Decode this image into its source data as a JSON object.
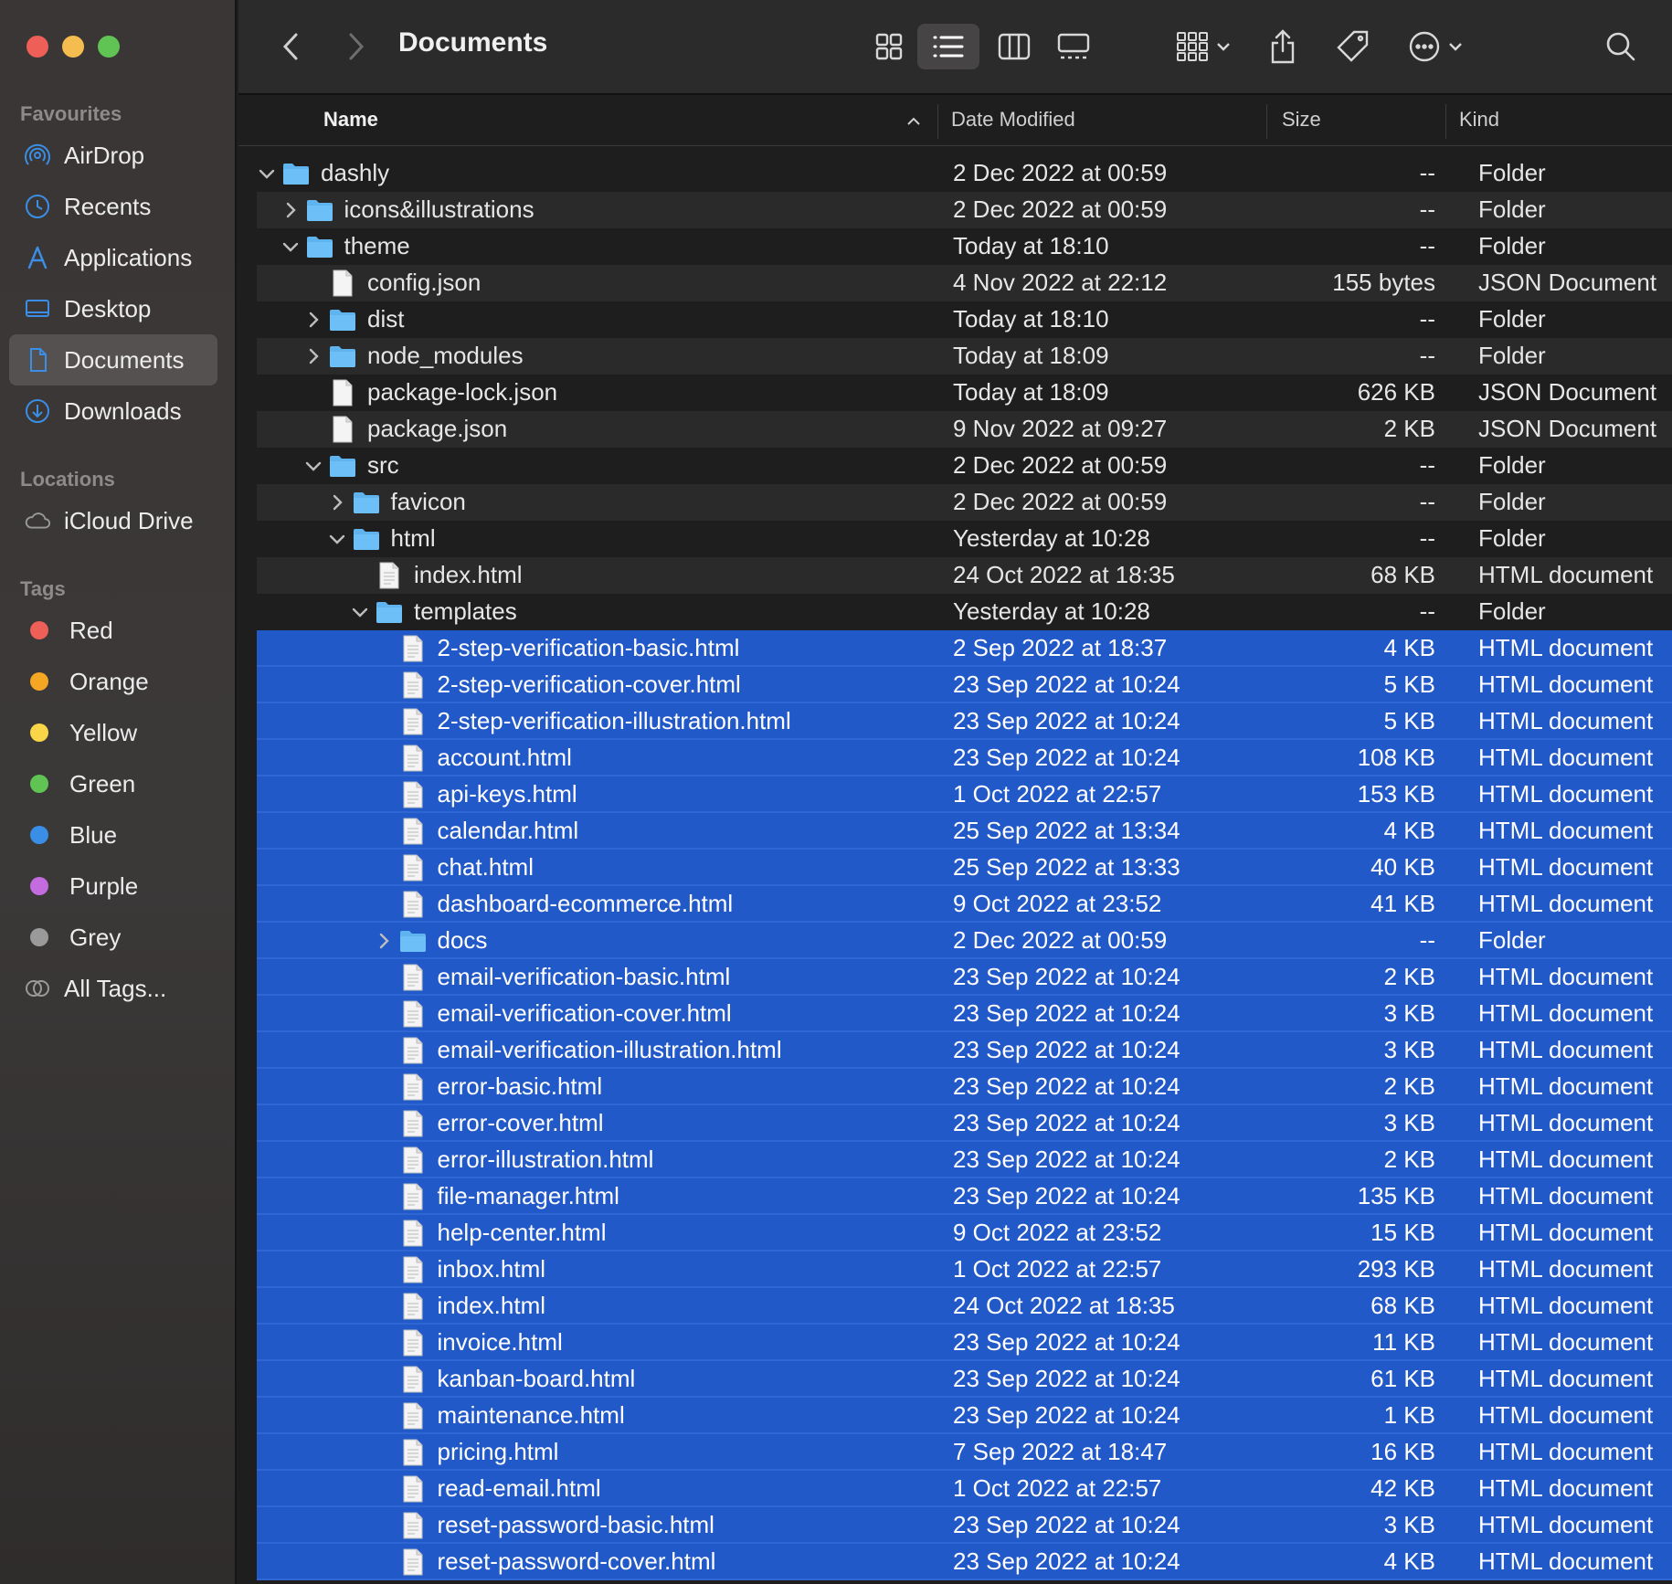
{
  "window": {
    "title": "Documents",
    "colors": {
      "selection": "#2259c9",
      "folder": "#5fb4f0",
      "sidebar_accent": "#3a8ee6"
    }
  },
  "sidebar": {
    "favourites_label": "Favourites",
    "favourites": [
      {
        "label": "AirDrop",
        "icon": "airdrop-icon"
      },
      {
        "label": "Recents",
        "icon": "clock-icon"
      },
      {
        "label": "Applications",
        "icon": "applications-icon"
      },
      {
        "label": "Desktop",
        "icon": "desktop-icon"
      },
      {
        "label": "Documents",
        "icon": "document-icon",
        "active": true
      },
      {
        "label": "Downloads",
        "icon": "download-icon"
      }
    ],
    "locations_label": "Locations",
    "locations": [
      {
        "label": "iCloud Drive",
        "icon": "cloud-icon"
      }
    ],
    "tags_label": "Tags",
    "tags": [
      {
        "label": "Red",
        "color": "#ed5f57"
      },
      {
        "label": "Orange",
        "color": "#f5a623"
      },
      {
        "label": "Yellow",
        "color": "#f8d648"
      },
      {
        "label": "Green",
        "color": "#5fc453"
      },
      {
        "label": "Blue",
        "color": "#3a8ee6"
      },
      {
        "label": "Purple",
        "color": "#c46be0"
      },
      {
        "label": "Grey",
        "color": "#9a9a9a"
      },
      {
        "label": "All Tags...",
        "color": ""
      }
    ]
  },
  "columns": {
    "name": "Name",
    "date": "Date Modified",
    "size": "Size",
    "kind": "Kind"
  },
  "files": [
    {
      "name": "dashly",
      "date": "2 Dec 2022 at 00:59",
      "size": "--",
      "kind": "Folder",
      "type": "folder",
      "level": 0,
      "expanded": true
    },
    {
      "name": "icons&illustrations",
      "date": "2 Dec 2022 at 00:59",
      "size": "--",
      "kind": "Folder",
      "type": "folder",
      "level": 1,
      "expanded": false
    },
    {
      "name": "theme",
      "date": "Today at 18:10",
      "size": "--",
      "kind": "Folder",
      "type": "folder",
      "level": 1,
      "expanded": true
    },
    {
      "name": "config.json",
      "date": "4 Nov 2022 at 22:12",
      "size": "155 bytes",
      "kind": "JSON Document",
      "type": "file",
      "level": 2
    },
    {
      "name": "dist",
      "date": "Today at 18:10",
      "size": "--",
      "kind": "Folder",
      "type": "folder",
      "level": 2,
      "expanded": false
    },
    {
      "name": "node_modules",
      "date": "Today at 18:09",
      "size": "--",
      "kind": "Folder",
      "type": "folder",
      "level": 2,
      "expanded": false
    },
    {
      "name": "package-lock.json",
      "date": "Today at 18:09",
      "size": "626 KB",
      "kind": "JSON Document",
      "type": "file",
      "level": 2
    },
    {
      "name": "package.json",
      "date": "9 Nov 2022 at 09:27",
      "size": "2 KB",
      "kind": "JSON Document",
      "type": "file",
      "level": 2
    },
    {
      "name": "src",
      "date": "2 Dec 2022 at 00:59",
      "size": "--",
      "kind": "Folder",
      "type": "folder",
      "level": 2,
      "expanded": true
    },
    {
      "name": "favicon",
      "date": "2 Dec 2022 at 00:59",
      "size": "--",
      "kind": "Folder",
      "type": "folder",
      "level": 3,
      "expanded": false
    },
    {
      "name": "html",
      "date": "Yesterday at 10:28",
      "size": "--",
      "kind": "Folder",
      "type": "folder",
      "level": 3,
      "expanded": true
    },
    {
      "name": "index.html",
      "date": "24 Oct 2022 at 18:35",
      "size": "68 KB",
      "kind": "HTML document",
      "type": "file",
      "level": 4
    },
    {
      "name": "templates",
      "date": "Yesterday at 10:28",
      "size": "--",
      "kind": "Folder",
      "type": "folder",
      "level": 4,
      "expanded": true
    },
    {
      "name": "2-step-verification-basic.html",
      "date": "2 Sep 2022 at 18:37",
      "size": "4 KB",
      "kind": "HTML document",
      "type": "file",
      "level": 5,
      "selected": true
    },
    {
      "name": "2-step-verification-cover.html",
      "date": "23 Sep 2022 at 10:24",
      "size": "5 KB",
      "kind": "HTML document",
      "type": "file",
      "level": 5,
      "selected": true
    },
    {
      "name": "2-step-verification-illustration.html",
      "date": "23 Sep 2022 at 10:24",
      "size": "5 KB",
      "kind": "HTML document",
      "type": "file",
      "level": 5,
      "selected": true
    },
    {
      "name": "account.html",
      "date": "23 Sep 2022 at 10:24",
      "size": "108 KB",
      "kind": "HTML document",
      "type": "file",
      "level": 5,
      "selected": true
    },
    {
      "name": "api-keys.html",
      "date": "1 Oct 2022 at 22:57",
      "size": "153 KB",
      "kind": "HTML document",
      "type": "file",
      "level": 5,
      "selected": true
    },
    {
      "name": "calendar.html",
      "date": "25 Sep 2022 at 13:34",
      "size": "4 KB",
      "kind": "HTML document",
      "type": "file",
      "level": 5,
      "selected": true
    },
    {
      "name": "chat.html",
      "date": "25 Sep 2022 at 13:33",
      "size": "40 KB",
      "kind": "HTML document",
      "type": "file",
      "level": 5,
      "selected": true
    },
    {
      "name": "dashboard-ecommerce.html",
      "date": "9 Oct 2022 at 23:52",
      "size": "41 KB",
      "kind": "HTML document",
      "type": "file",
      "level": 5,
      "selected": true
    },
    {
      "name": "docs",
      "date": "2 Dec 2022 at 00:59",
      "size": "--",
      "kind": "Folder",
      "type": "folder",
      "level": 5,
      "expanded": false,
      "selected": true
    },
    {
      "name": "email-verification-basic.html",
      "date": "23 Sep 2022 at 10:24",
      "size": "2 KB",
      "kind": "HTML document",
      "type": "file",
      "level": 5,
      "selected": true
    },
    {
      "name": "email-verification-cover.html",
      "date": "23 Sep 2022 at 10:24",
      "size": "3 KB",
      "kind": "HTML document",
      "type": "file",
      "level": 5,
      "selected": true
    },
    {
      "name": "email-verification-illustration.html",
      "date": "23 Sep 2022 at 10:24",
      "size": "3 KB",
      "kind": "HTML document",
      "type": "file",
      "level": 5,
      "selected": true
    },
    {
      "name": "error-basic.html",
      "date": "23 Sep 2022 at 10:24",
      "size": "2 KB",
      "kind": "HTML document",
      "type": "file",
      "level": 5,
      "selected": true
    },
    {
      "name": "error-cover.html",
      "date": "23 Sep 2022 at 10:24",
      "size": "3 KB",
      "kind": "HTML document",
      "type": "file",
      "level": 5,
      "selected": true
    },
    {
      "name": "error-illustration.html",
      "date": "23 Sep 2022 at 10:24",
      "size": "2 KB",
      "kind": "HTML document",
      "type": "file",
      "level": 5,
      "selected": true
    },
    {
      "name": "file-manager.html",
      "date": "23 Sep 2022 at 10:24",
      "size": "135 KB",
      "kind": "HTML document",
      "type": "file",
      "level": 5,
      "selected": true
    },
    {
      "name": "help-center.html",
      "date": "9 Oct 2022 at 23:52",
      "size": "15 KB",
      "kind": "HTML document",
      "type": "file",
      "level": 5,
      "selected": true
    },
    {
      "name": "inbox.html",
      "date": "1 Oct 2022 at 22:57",
      "size": "293 KB",
      "kind": "HTML document",
      "type": "file",
      "level": 5,
      "selected": true
    },
    {
      "name": "index.html",
      "date": "24 Oct 2022 at 18:35",
      "size": "68 KB",
      "kind": "HTML document",
      "type": "file",
      "level": 5,
      "selected": true
    },
    {
      "name": "invoice.html",
      "date": "23 Sep 2022 at 10:24",
      "size": "11 KB",
      "kind": "HTML document",
      "type": "file",
      "level": 5,
      "selected": true
    },
    {
      "name": "kanban-board.html",
      "date": "23 Sep 2022 at 10:24",
      "size": "61 KB",
      "kind": "HTML document",
      "type": "file",
      "level": 5,
      "selected": true
    },
    {
      "name": "maintenance.html",
      "date": "23 Sep 2022 at 10:24",
      "size": "1 KB",
      "kind": "HTML document",
      "type": "file",
      "level": 5,
      "selected": true
    },
    {
      "name": "pricing.html",
      "date": "7 Sep 2022 at 18:47",
      "size": "16 KB",
      "kind": "HTML document",
      "type": "file",
      "level": 5,
      "selected": true
    },
    {
      "name": "read-email.html",
      "date": "1 Oct 2022 at 22:57",
      "size": "42 KB",
      "kind": "HTML document",
      "type": "file",
      "level": 5,
      "selected": true
    },
    {
      "name": "reset-password-basic.html",
      "date": "23 Sep 2022 at 10:24",
      "size": "3 KB",
      "kind": "HTML document",
      "type": "file",
      "level": 5,
      "selected": true
    },
    {
      "name": "reset-password-cover.html",
      "date": "23 Sep 2022 at 10:24",
      "size": "4 KB",
      "kind": "HTML document",
      "type": "file",
      "level": 5,
      "selected": true
    }
  ]
}
